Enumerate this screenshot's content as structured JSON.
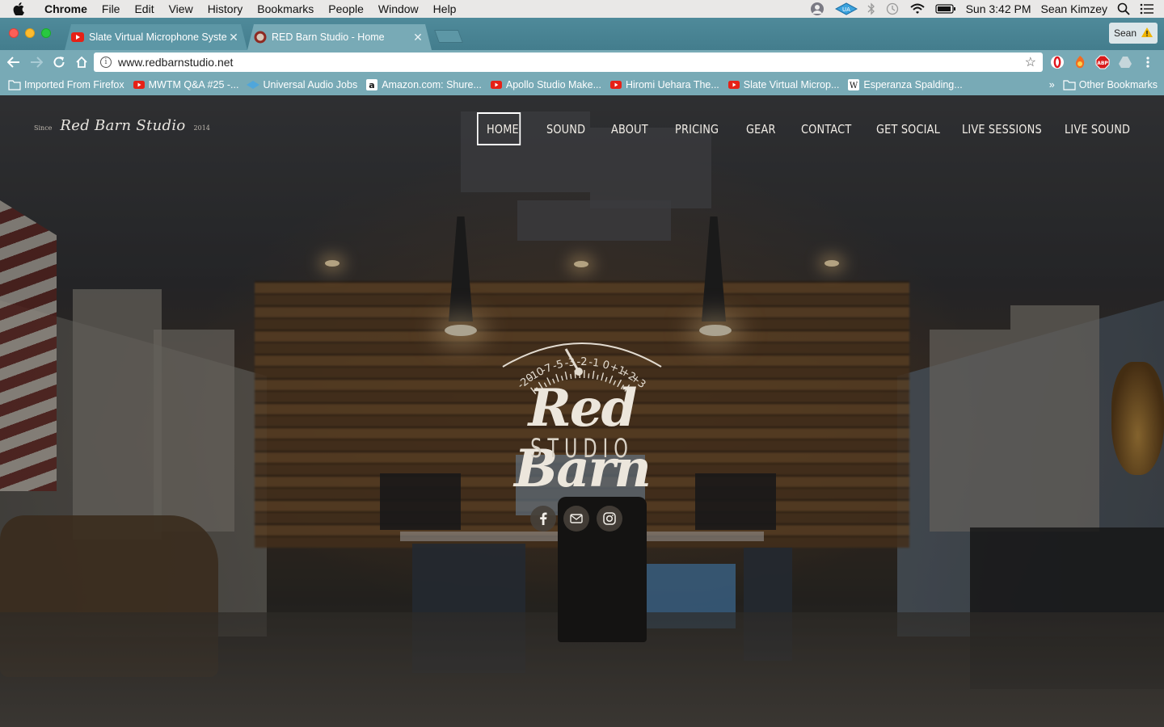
{
  "menubar": {
    "app_name": "Chrome",
    "items": [
      "File",
      "Edit",
      "View",
      "History",
      "Bookmarks",
      "People",
      "Window",
      "Help"
    ],
    "clock": "Sun 3:42 PM",
    "user": "Sean Kimzey"
  },
  "browser": {
    "tabs": [
      {
        "title": "Slate Virtual Microphone Syste",
        "active": false
      },
      {
        "title": "RED Barn Studio - Home",
        "active": true
      }
    ],
    "profile_name": "Sean",
    "url": "www.redbarnstudio.net",
    "bookmarks": [
      {
        "label": "Imported From Firefox",
        "icon": "folder-icon"
      },
      {
        "label": "MWTM Q&A #25 -...",
        "icon": "youtube-icon"
      },
      {
        "label": "Universal Audio Jobs",
        "icon": "ua-icon"
      },
      {
        "label": "Amazon.com: Shure...",
        "icon": "amazon-icon"
      },
      {
        "label": "Apollo Studio Make...",
        "icon": "youtube-icon"
      },
      {
        "label": "Hiromi Uehara The...",
        "icon": "youtube-icon"
      },
      {
        "label": "Slate Virtual Microp...",
        "icon": "youtube-icon"
      },
      {
        "label": "Esperanza Spalding...",
        "icon": "wikipedia-icon"
      }
    ],
    "other_bookmarks": "Other Bookmarks",
    "overflow_label": "»"
  },
  "site": {
    "logo": {
      "since": "Since",
      "name": "Red Barn Studio",
      "year": "2014"
    },
    "nav": [
      "HOME",
      "SOUND",
      "ABOUT",
      "PRICING",
      "GEAR",
      "CONTACT",
      "GET SOCIAL",
      "LIVE SESSIONS",
      "LIVE SOUND"
    ],
    "active_nav": "HOME",
    "hero": {
      "wordmark": "Red Barn",
      "subword": "STUDIO",
      "meter_scale": [
        "-20",
        "-10",
        "-7",
        "-5",
        "-3",
        "-2",
        "-1",
        "0",
        "+1",
        "+2",
        "+3"
      ]
    },
    "socials": [
      "facebook-icon",
      "mail-icon",
      "instagram-icon"
    ]
  }
}
